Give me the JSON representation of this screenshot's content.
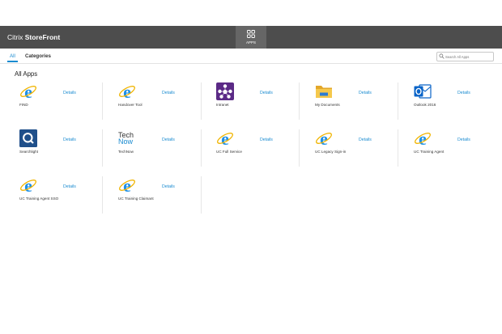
{
  "header": {
    "brand_light": "Citrix ",
    "brand_bold": "StoreFront",
    "apps_label": "APPS"
  },
  "tabs": {
    "all": "All",
    "categories": "Categories"
  },
  "search": {
    "placeholder": "Search All Apps"
  },
  "section_title": "All Apps",
  "details_label": "Details",
  "apps": [
    {
      "name": "FIND",
      "icon": "internet-explorer-icon"
    },
    {
      "name": "Handover Tool",
      "icon": "internet-explorer-icon"
    },
    {
      "name": "Intranet",
      "icon": "intranet-icon"
    },
    {
      "name": "My Documents",
      "icon": "folder-icon"
    },
    {
      "name": "Outlook 2016",
      "icon": "outlook-icon"
    },
    {
      "name": "Searchlight",
      "icon": "searchlight-icon"
    },
    {
      "name": "TechNow",
      "icon": "technow-icon",
      "icon_text_1": "Tech",
      "icon_text_2": "Now"
    },
    {
      "name": "UC Full Service",
      "icon": "internet-explorer-icon"
    },
    {
      "name": "UC Legacy Sign-in",
      "icon": "internet-explorer-icon"
    },
    {
      "name": "UC Training Agent",
      "icon": "internet-explorer-icon"
    },
    {
      "name": "UC Training Agent SSO",
      "icon": "internet-explorer-icon"
    },
    {
      "name": "UC Training Claimant",
      "icon": "internet-explorer-icon"
    }
  ],
  "colors": {
    "header": "#4d4d4d",
    "accent": "#1a8bd0",
    "ie_blue": "#1e90e6",
    "ie_ring": "#f0b400"
  }
}
